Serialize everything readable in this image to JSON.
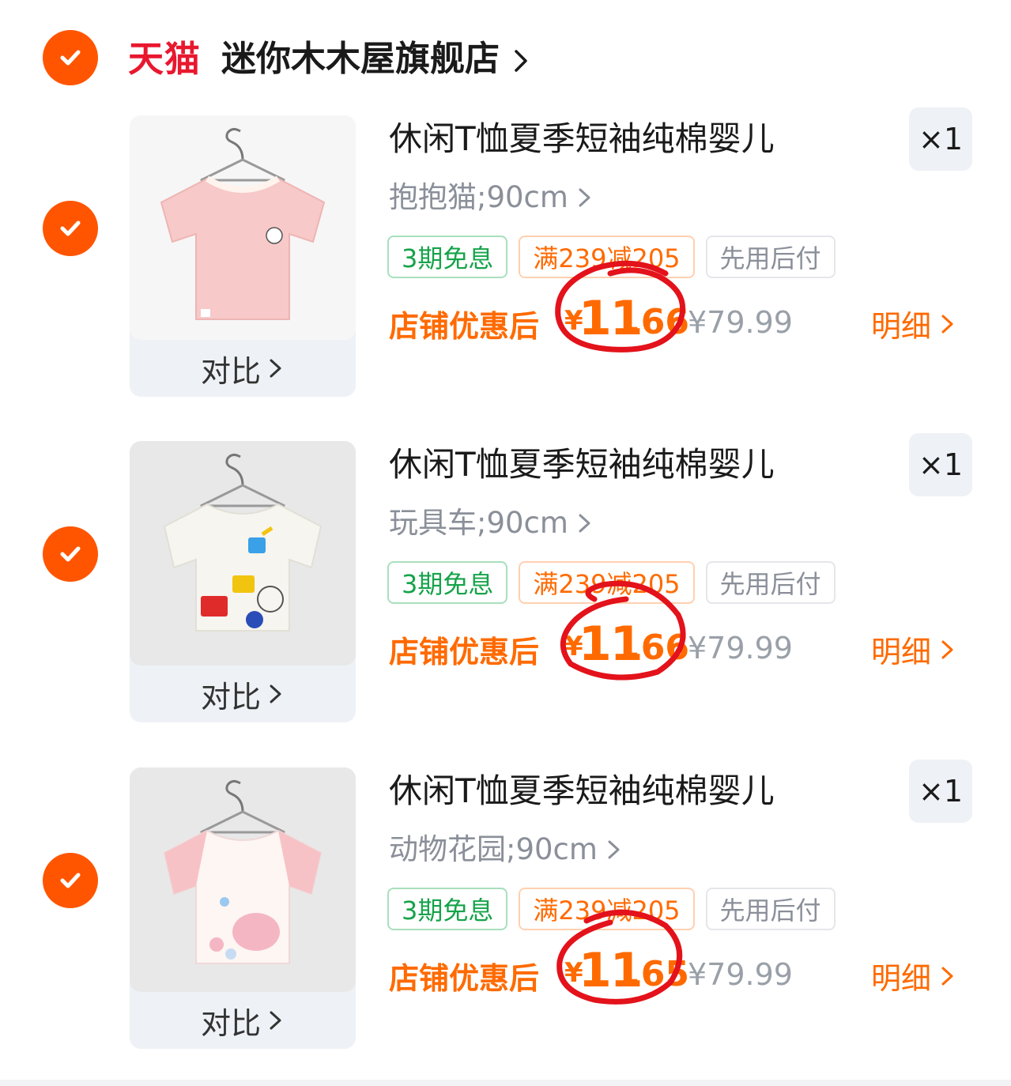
{
  "store": {
    "platform_logo": "天猫",
    "name": "迷你木木屋旗舰店",
    "selected": true
  },
  "items": [
    {
      "title": "休闲T恤夏季短袖纯棉婴儿",
      "spec": "抱抱猫;90cm",
      "quantity": "×1",
      "tags": [
        "3期免息",
        "满239减205",
        "先用后付"
      ],
      "price_label": "店铺优惠后",
      "currency": "¥",
      "price_int": "11",
      "price_dec": ".66",
      "original_price": "¥79.99",
      "detail": "明细",
      "compare": "对比",
      "selected": true,
      "image_color": "#f7c9c8"
    },
    {
      "title": "休闲T恤夏季短袖纯棉婴儿",
      "spec": "玩具车;90cm",
      "quantity": "×1",
      "tags": [
        "3期免息",
        "满239减205",
        "先用后付"
      ],
      "price_label": "店铺优惠后",
      "currency": "¥",
      "price_int": "11",
      "price_dec": ".66",
      "original_price": "¥79.99",
      "detail": "明细",
      "compare": "对比",
      "selected": true,
      "image_color": "#f7f5ef"
    },
    {
      "title": "休闲T恤夏季短袖纯棉婴儿",
      "spec": "动物花园;90cm",
      "quantity": "×1",
      "tags": [
        "3期免息",
        "满239减205",
        "先用后付"
      ],
      "price_label": "店铺优惠后",
      "currency": "¥",
      "price_int": "11",
      "price_dec": ".65",
      "original_price": "¥79.99",
      "detail": "明细",
      "compare": "对比",
      "selected": true,
      "image_color": "#fbe0e2"
    }
  ],
  "colors": {
    "accent": "#ff5500",
    "price": "#ff6a00",
    "tmall_red": "#e8182f",
    "annotation_red": "#e3121b"
  }
}
